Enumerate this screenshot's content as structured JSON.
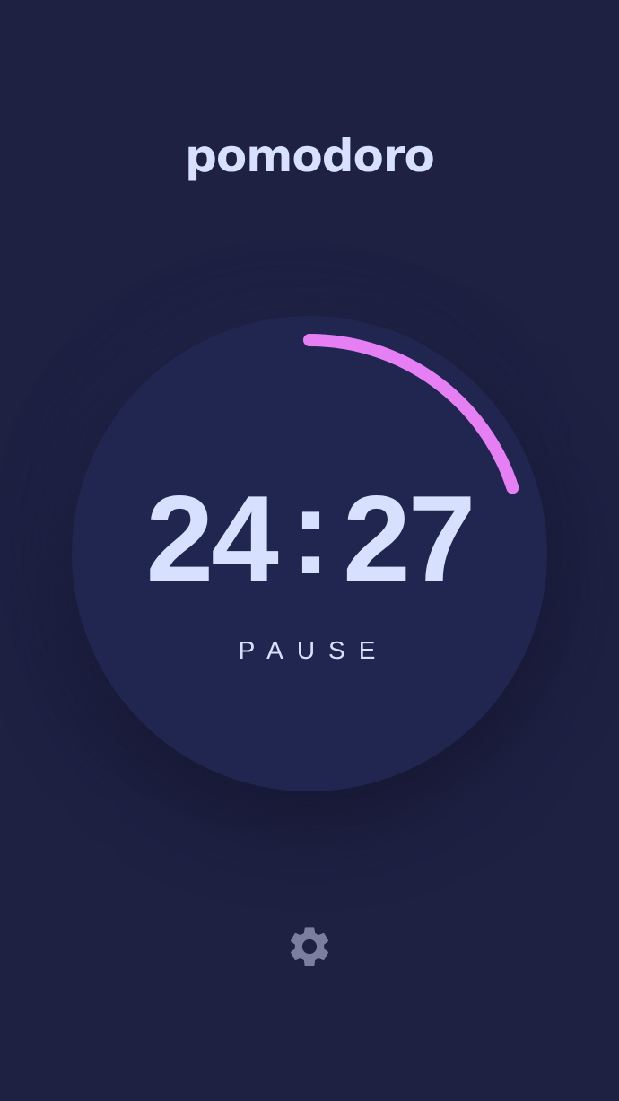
{
  "app": {
    "title": "pomodoro"
  },
  "timer": {
    "minutes": "24",
    "separator": ":",
    "seconds": "27",
    "action_label": "PAUSE",
    "progress_fraction": 0.2,
    "accent_color": "#e77ff4"
  },
  "settings": {
    "icon": "gear-icon"
  }
}
